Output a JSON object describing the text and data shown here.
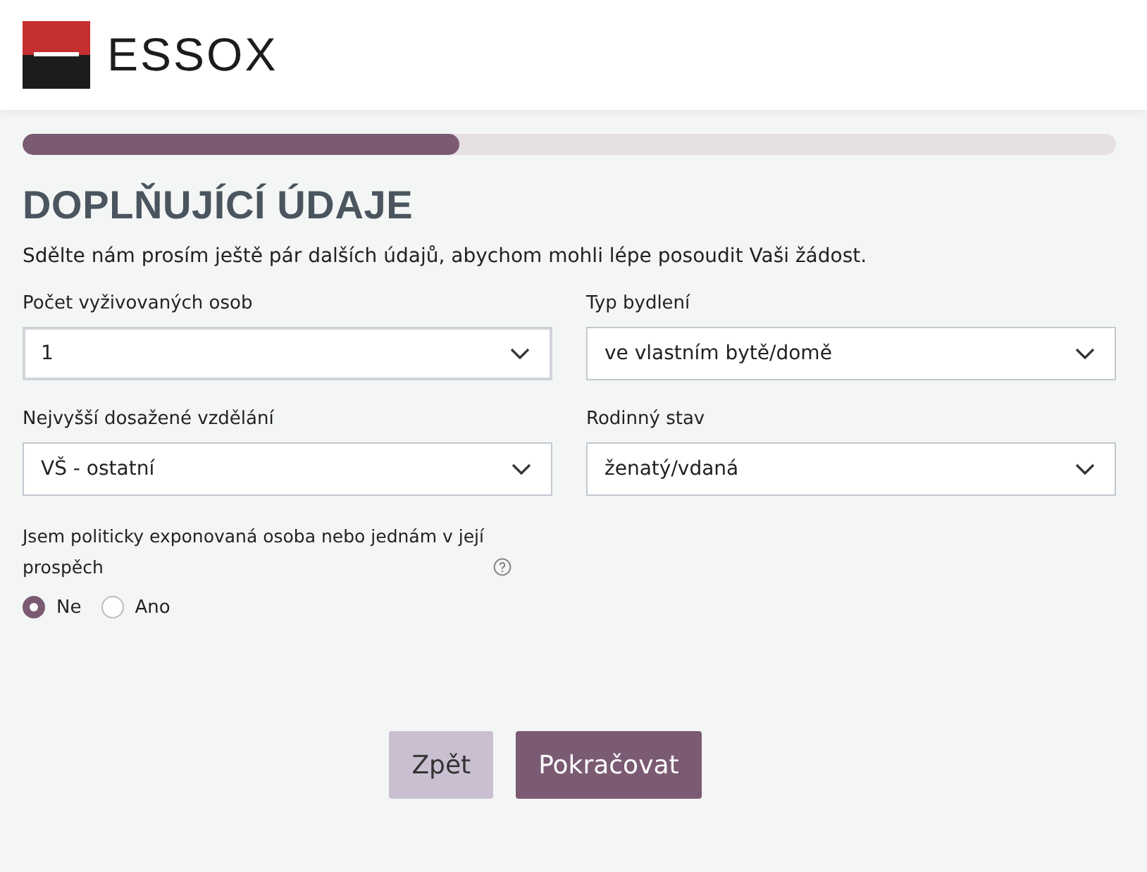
{
  "header": {
    "logo_text": "ESSOX"
  },
  "progress": {
    "level": 0.4
  },
  "heading": "DOPLŇUJÍCÍ ÚDAJE",
  "intro": "Sdělte nám prosím ještě pár dalších údajů, abychom mohli lépe posoudit Vaši žádost.",
  "fields": [
    {
      "label": "Počet vyživovaných osob",
      "value": "1",
      "focused": true
    },
    {
      "label": "Typ bydlení",
      "value": "ve vlastním bytě/domě",
      "focused": false
    },
    {
      "label": "Nejvyšší dosažené vzdělání",
      "value": "VŠ - ostatní",
      "focused": false
    },
    {
      "label": "Rodinný stav",
      "value": "ženatý/vdaná",
      "focused": false
    }
  ],
  "question": {
    "label": "Jsem politicky exponovaná osoba nebo jednám v její prospěch",
    "options": [
      {
        "label": "Ne",
        "selected": true
      },
      {
        "label": "Ano",
        "selected": false
      }
    ]
  },
  "buttons": [
    {
      "label": "Zpět",
      "kind": "secondary"
    },
    {
      "label": "Pokračovat",
      "kind": "primary"
    }
  ]
}
